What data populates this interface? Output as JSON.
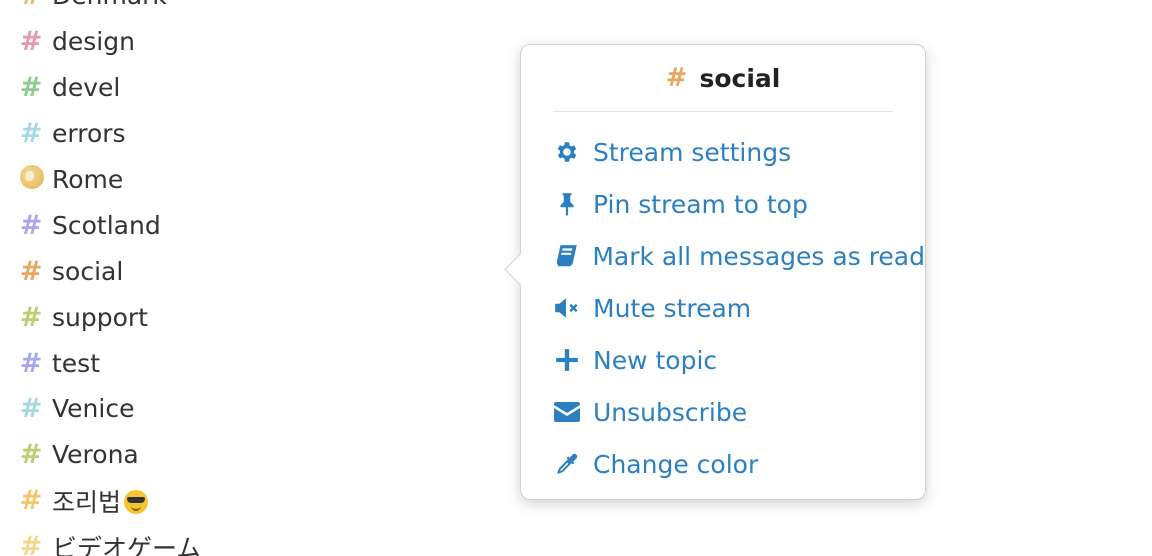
{
  "streams": [
    {
      "name": "Denmark",
      "icon": "hash-icon",
      "color": "#e6b86f"
    },
    {
      "name": "design",
      "icon": "hash-icon",
      "color": "#e39aae"
    },
    {
      "name": "devel",
      "icon": "hash-icon",
      "color": "#8fcb8f"
    },
    {
      "name": "errors",
      "icon": "hash-icon",
      "color": "#a6d8e3"
    },
    {
      "name": "Rome",
      "icon": "globe-icon",
      "color": "#e9c36a"
    },
    {
      "name": "Scotland",
      "icon": "hash-icon",
      "color": "#a9a6ee"
    },
    {
      "name": "social",
      "icon": "hash-icon",
      "color": "#e8a85c"
    },
    {
      "name": "support",
      "icon": "hash-icon",
      "color": "#b9cf72"
    },
    {
      "name": "test",
      "icon": "hash-icon",
      "color": "#a9a6ee"
    },
    {
      "name": "Venice",
      "icon": "hash-icon",
      "color": "#a6d8e3"
    },
    {
      "name": "Verona",
      "icon": "hash-icon",
      "color": "#b9cf72"
    },
    {
      "name": "조리법",
      "icon": "hash-icon",
      "color": "#f0c66b",
      "emoji": "sunglasses-emoji"
    },
    {
      "name": "ビデオゲーム",
      "icon": "hash-icon",
      "color": "#f2d88a"
    }
  ],
  "popover": {
    "title": "social",
    "title_icon": "hash-icon",
    "title_color": "#e8a85c",
    "accent_color": "#2c80c0",
    "items": [
      {
        "label": "Stream settings",
        "icon": "gear-icon"
      },
      {
        "label": "Pin stream to top",
        "icon": "pin-icon"
      },
      {
        "label": "Mark all messages as read",
        "icon": "book-icon"
      },
      {
        "label": "Mute stream",
        "icon": "mute-icon"
      },
      {
        "label": "New topic",
        "icon": "plus-icon"
      },
      {
        "label": "Unsubscribe",
        "icon": "envelope-icon"
      },
      {
        "label": "Change color",
        "icon": "eyedropper-icon"
      }
    ]
  }
}
